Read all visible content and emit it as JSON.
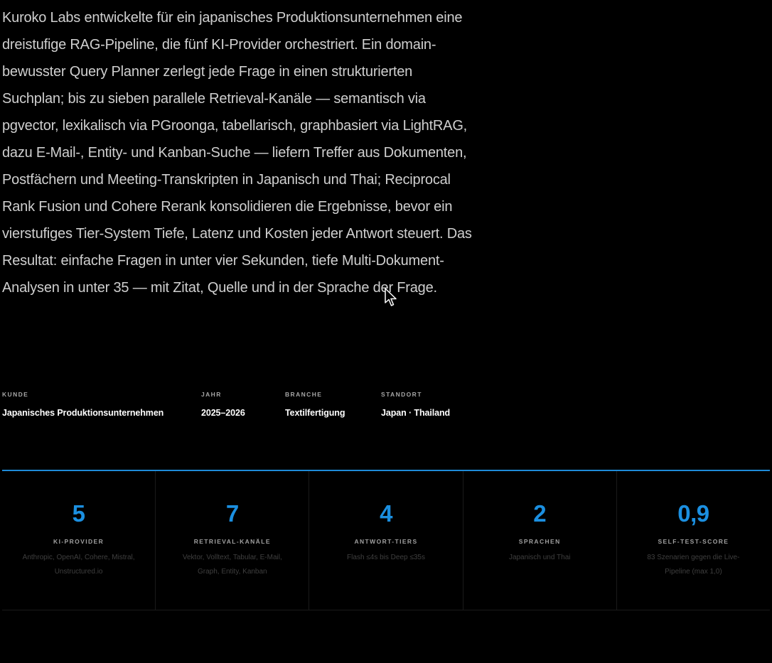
{
  "intro": {
    "text": "Kuroko Labs entwickelte für ein japanisches Produktionsunternehmen eine dreistufige RAG-Pipeline, die fünf KI-Provider orchestriert. Ein domain-bewusster Query Planner zerlegt jede Frage in einen strukturierten Suchplan; bis zu sieben parallele Retrieval-Kanäle — semantisch via pgvector, lexikalisch via PGroonga, tabellarisch, graphbasiert via LightRAG, dazu E-Mail-, Entity- und Kanban-Suche — liefern Treffer aus Dokumenten, Postfächern und Meeting-Transkripten in Japanisch und Thai; Reciprocal Rank Fusion und Cohere Rerank konsolidieren die Ergebnisse, bevor ein vierstufiges Tier-System Tiefe, Latenz und Kosten jeder Antwort steuert. Das Resultat: einfache Fragen in unter vier Sekunden, tiefe Multi-Dokument-Analysen in unter 35 — mit Zitat, Quelle und in der Sprache der Frage."
  },
  "meta": [
    {
      "label": "KUNDE",
      "value": "Japanisches Produktionsunternehmen"
    },
    {
      "label": "JAHR",
      "value": "2025–2026"
    },
    {
      "label": "BRANCHE",
      "value": "Textilfertigung"
    },
    {
      "label": "STANDORT",
      "value": "Japan · Thailand"
    }
  ],
  "stats": [
    {
      "value": "5",
      "label": "KI-PROVIDER",
      "desc": "Anthropic, OpenAI, Cohere, Mistral, Unstructured.io"
    },
    {
      "value": "7",
      "label": "RETRIEVAL-KANÄLE",
      "desc": "Vektor, Volltext, Tabular, E-Mail, Graph, Entity, Kanban"
    },
    {
      "value": "4",
      "label": "ANTWORT-TIERS",
      "desc": "Flash ≤4s bis Deep ≤35s"
    },
    {
      "value": "2",
      "label": "SPRACHEN",
      "desc": "Japanisch und Thai"
    },
    {
      "value": "0,9",
      "label": "SELF-TEST-SCORE",
      "desc": "83 Szenarien gegen die Live-Pipeline (max 1,0)"
    }
  ],
  "colors": {
    "background": "#000000",
    "accent": "#1b8fe0",
    "divider": "#1e8ad8"
  },
  "icons": {
    "cursor": "mouse-pointer-icon"
  }
}
